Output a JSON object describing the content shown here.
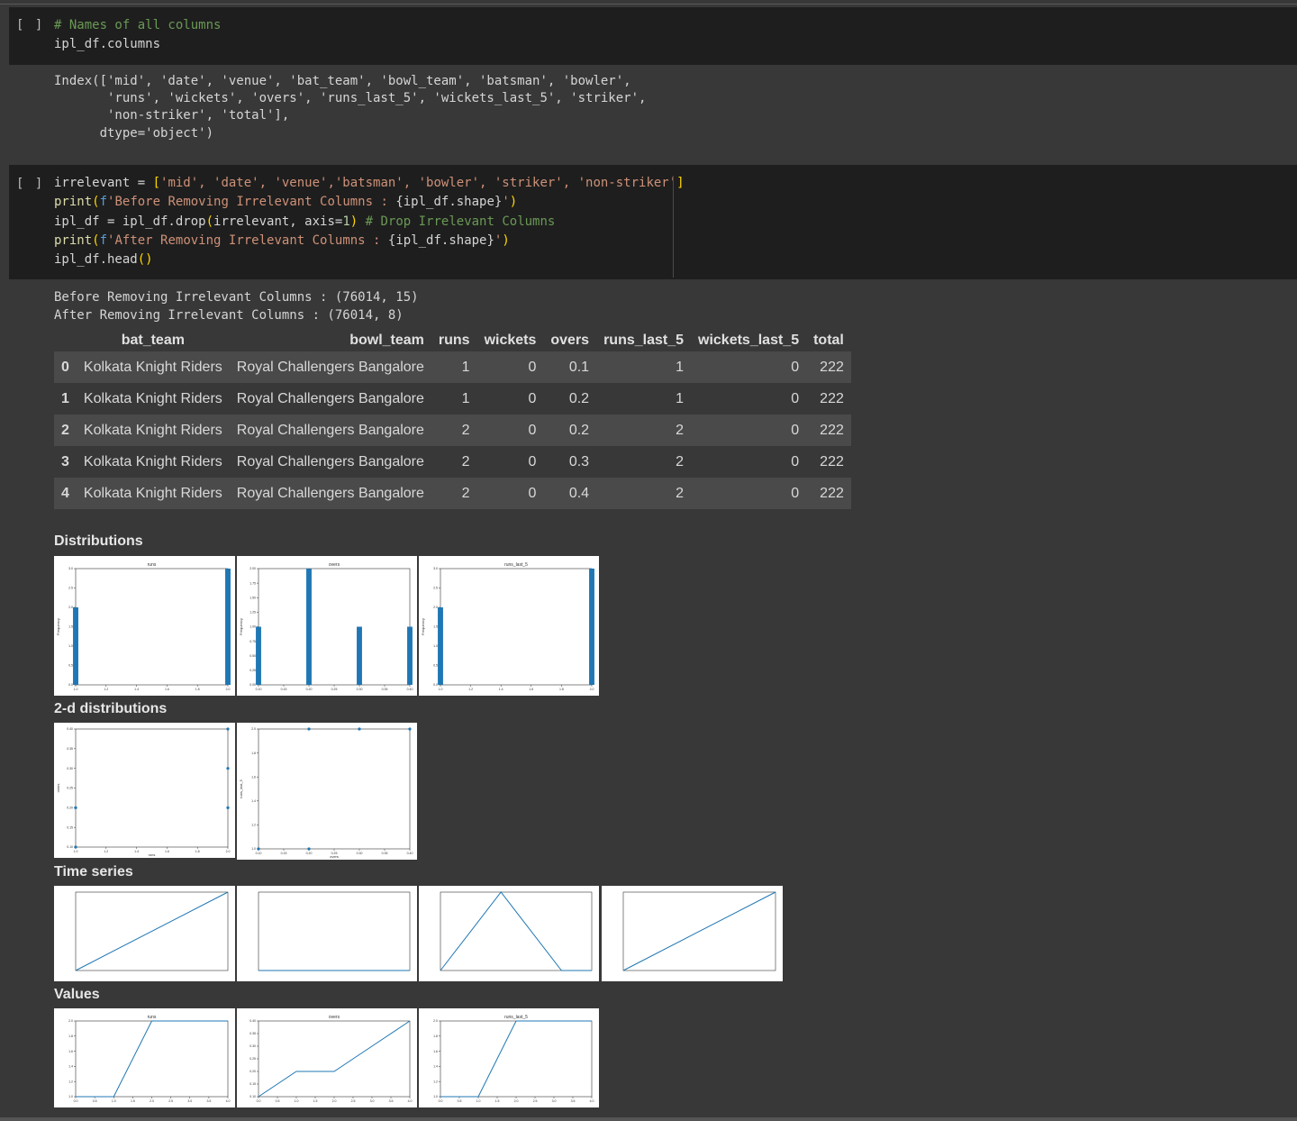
{
  "cell1": {
    "run": "[ ]",
    "comment": "# Names of all columns",
    "line2": "ipl_df.columns",
    "output": [
      "Index(['mid', 'date', 'venue', 'bat_team', 'bowl_team', 'batsman', 'bowler',",
      "       'runs', 'wickets', 'overs', 'runs_last_5', 'wickets_last_5', 'striker',",
      "       'non-striker', 'total'],",
      "      dtype='object')"
    ]
  },
  "cell2": {
    "run": "[ ]",
    "l1_a": "irrelevant = ",
    "l1_b": "[",
    "l1_c": "'mid', 'date', 'venue','batsman', 'bowler', 'striker', 'non-striker'",
    "l1_d": "]",
    "l2_a": "print",
    "l2_b": "(",
    "l2_c": "f",
    "l2_d": "'Before Removing Irrelevant Columns : ",
    "l2_e": "{ipl_df.shape}",
    "l2_f": "'",
    "l2_g": ")",
    "l3_a": "ipl_df = ipl_df.drop",
    "l3_b": "(",
    "l3_c": "irrelevant, axis=",
    "l3_d": "1",
    "l3_e": ")",
    "l3_f": " # Drop Irrelevant Columns",
    "l4_a": "print",
    "l4_b": "(",
    "l4_c": "f",
    "l4_d": "'After Removing Irrelevant Columns : ",
    "l4_e": "{ipl_df.shape}",
    "l4_f": "'",
    "l4_g": ")",
    "l5_a": "ipl_df.head",
    "l5_b": "()",
    "output": [
      "Before Removing Irrelevant Columns : (76014, 15)",
      "After Removing Irrelevant Columns : (76014, 8)"
    ]
  },
  "table": {
    "columns": [
      "",
      "bat_team",
      "bowl_team",
      "runs",
      "wickets",
      "overs",
      "runs_last_5",
      "wickets_last_5",
      "total"
    ],
    "rows": [
      [
        "0",
        "Kolkata Knight Riders",
        "Royal Challengers Bangalore",
        "1",
        "0",
        "0.1",
        "1",
        "0",
        "222"
      ],
      [
        "1",
        "Kolkata Knight Riders",
        "Royal Challengers Bangalore",
        "1",
        "0",
        "0.2",
        "1",
        "0",
        "222"
      ],
      [
        "2",
        "Kolkata Knight Riders",
        "Royal Challengers Bangalore",
        "2",
        "0",
        "0.2",
        "2",
        "0",
        "222"
      ],
      [
        "3",
        "Kolkata Knight Riders",
        "Royal Challengers Bangalore",
        "2",
        "0",
        "0.3",
        "2",
        "0",
        "222"
      ],
      [
        "4",
        "Kolkata Knight Riders",
        "Royal Challengers Bangalore",
        "2",
        "0",
        "0.4",
        "2",
        "0",
        "222"
      ]
    ]
  },
  "sections": {
    "distributions": "Distributions",
    "distributions_2d": "2-d distributions",
    "time_series": "Time series",
    "values": "Values"
  },
  "colors": {
    "plot_blue": "#1f77b4",
    "accent_green": "#6a9955",
    "string_orange": "#ce9178"
  },
  "chart_data": [
    {
      "id": "dist_runs",
      "type": "bar",
      "title": "runs",
      "ylabel": "Frequency",
      "x": [
        1.0,
        2.0
      ],
      "values": [
        2,
        3
      ],
      "xlim": [
        1.0,
        2.0
      ],
      "ylim": [
        0,
        3.0
      ],
      "xticks": [
        "1.0",
        "1.2",
        "1.4",
        "1.6",
        "1.8",
        "2.0"
      ],
      "yticks": [
        "0.0",
        "0.5",
        "1.0",
        "1.5",
        "2.0",
        "2.5",
        "3.0"
      ]
    },
    {
      "id": "dist_overs",
      "type": "bar",
      "title": "overs",
      "ylabel": "Frequency",
      "x": [
        0.1,
        0.2,
        0.3,
        0.4
      ],
      "values": [
        1,
        2,
        1,
        1
      ],
      "xlim": [
        0.1,
        0.4
      ],
      "ylim": [
        0,
        2.0
      ],
      "xticks": [
        "0.10",
        "0.15",
        "0.20",
        "0.25",
        "0.30",
        "0.35",
        "0.40"
      ],
      "yticks": [
        "0.00",
        "0.25",
        "0.50",
        "0.75",
        "1.00",
        "1.25",
        "1.50",
        "1.75",
        "2.00"
      ]
    },
    {
      "id": "dist_runs_last_5",
      "type": "bar",
      "title": "runs_last_5",
      "ylabel": "Frequency",
      "x": [
        1.0,
        2.0
      ],
      "values": [
        2,
        3
      ],
      "xlim": [
        1.0,
        2.0
      ],
      "ylim": [
        0,
        3.0
      ],
      "xticks": [
        "1.0",
        "1.2",
        "1.4",
        "1.6",
        "1.8",
        "2.0"
      ],
      "yticks": [
        "0.0",
        "0.5",
        "1.0",
        "1.5",
        "2.0",
        "2.5",
        "3.0"
      ]
    },
    {
      "id": "scatter_runs_overs",
      "type": "scatter",
      "xlabel": "runs",
      "ylabel": "overs",
      "x": [
        1,
        1,
        2,
        2,
        2
      ],
      "y": [
        0.1,
        0.2,
        0.2,
        0.3,
        0.4
      ],
      "xlim": [
        1.0,
        2.0
      ],
      "ylim": [
        0.1,
        0.4
      ],
      "xticks": [
        "1.0",
        "1.2",
        "1.4",
        "1.6",
        "1.8",
        "2.0"
      ],
      "yticks": [
        "0.10",
        "0.15",
        "0.20",
        "0.25",
        "0.30",
        "0.35",
        "0.40"
      ]
    },
    {
      "id": "scatter_overs_runs_last_5",
      "type": "scatter",
      "xlabel": "overs",
      "ylabel": "runs_last_5",
      "x": [
        0.1,
        0.2,
        0.2,
        0.3,
        0.4
      ],
      "y": [
        1,
        1,
        2,
        2,
        2
      ],
      "xlim": [
        0.1,
        0.4
      ],
      "ylim": [
        1.0,
        2.0
      ],
      "xticks": [
        "0.10",
        "0.15",
        "0.20",
        "0.25",
        "0.30",
        "0.35",
        "0.40"
      ],
      "yticks": [
        "1.0",
        "1.2",
        "1.4",
        "1.6",
        "1.8",
        "2.0"
      ]
    },
    {
      "id": "ts_1",
      "type": "line",
      "x": [
        0,
        4
      ],
      "y": [
        0,
        4
      ],
      "xlim": [
        0,
        4
      ],
      "ylim": [
        0,
        4
      ]
    },
    {
      "id": "ts_2",
      "type": "line",
      "x": [
        0,
        4
      ],
      "y": [
        0,
        0
      ],
      "xlim": [
        0,
        4
      ],
      "ylim": [
        0,
        1
      ]
    },
    {
      "id": "ts_3",
      "type": "line",
      "x": [
        0,
        2,
        4,
        5
      ],
      "y": [
        0,
        2,
        0,
        0
      ],
      "xlim": [
        0,
        5
      ],
      "ylim": [
        0,
        2
      ]
    },
    {
      "id": "ts_4",
      "type": "line",
      "x": [
        0,
        4
      ],
      "y": [
        0,
        4
      ],
      "xlim": [
        0,
        4
      ],
      "ylim": [
        0,
        4
      ]
    },
    {
      "id": "values_runs",
      "type": "line",
      "title": "runs",
      "x": [
        0,
        1,
        2,
        3,
        4
      ],
      "y": [
        1,
        1,
        2,
        2,
        2
      ],
      "xlim": [
        0,
        4
      ],
      "ylim": [
        1.0,
        2.0
      ],
      "xticks": [
        "0.0",
        "0.5",
        "1.0",
        "1.5",
        "2.0",
        "2.5",
        "3.0",
        "3.5",
        "4.0"
      ],
      "yticks": [
        "1.0",
        "1.2",
        "1.4",
        "1.6",
        "1.8",
        "2.0"
      ]
    },
    {
      "id": "values_overs",
      "type": "line",
      "title": "overs",
      "x": [
        0,
        1,
        2,
        3,
        4
      ],
      "y": [
        0.1,
        0.2,
        0.2,
        0.3,
        0.4
      ],
      "xlim": [
        0,
        4
      ],
      "ylim": [
        0.1,
        0.4
      ],
      "xticks": [
        "0.0",
        "0.5",
        "1.0",
        "1.5",
        "2.0",
        "2.5",
        "3.0",
        "3.5",
        "4.0"
      ],
      "yticks": [
        "0.10",
        "0.15",
        "0.20",
        "0.25",
        "0.30",
        "0.35",
        "0.40"
      ]
    },
    {
      "id": "values_runs_last_5",
      "type": "line",
      "title": "runs_last_5",
      "x": [
        0,
        1,
        2,
        3,
        4
      ],
      "y": [
        1,
        1,
        2,
        2,
        2
      ],
      "xlim": [
        0,
        4
      ],
      "ylim": [
        1.0,
        2.0
      ],
      "xticks": [
        "0.0",
        "0.5",
        "1.0",
        "1.5",
        "2.0",
        "2.5",
        "3.0",
        "3.5",
        "4.0"
      ],
      "yticks": [
        "1.0",
        "1.2",
        "1.4",
        "1.6",
        "1.8",
        "2.0"
      ]
    }
  ]
}
